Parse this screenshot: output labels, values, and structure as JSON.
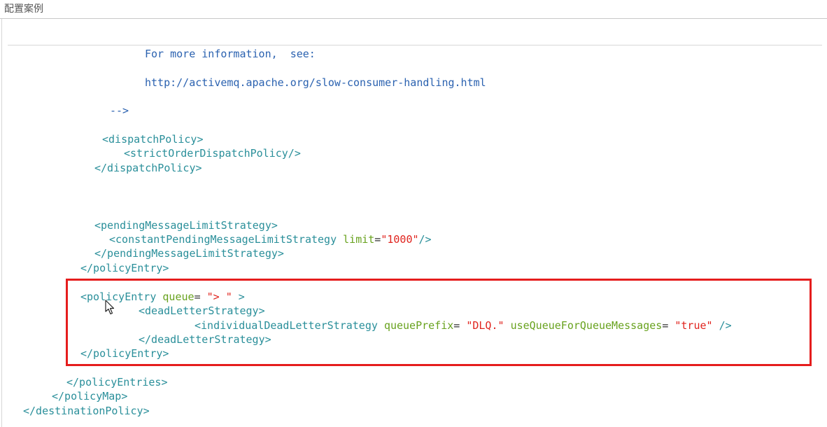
{
  "header": {
    "title": "配置案例"
  },
  "code": {
    "comment_1": "For more information,  see:",
    "comment_2": "http://activemq.apache.org/slow-consumer-handling.html",
    "comment_end": "-->",
    "dispatch_open": "<dispatchPolicy>",
    "strict_order": "<strictOrderDispatchPolicy/>",
    "dispatch_close": "</dispatchPolicy>",
    "pending_open": "<pendingMessageLimitStrategy>",
    "constant_open": "<constantPendingMessageLimitStrategy",
    "limit_attr": "limit",
    "limit_eq": "=",
    "limit_val": "\"1000\"",
    "constant_close": "/>",
    "pending_close": "</pendingMessageLimitStrategy>",
    "policy_entry_close_1": "</policyEntry>",
    "policy_entry_open": "<policyEntry",
    "queue_attr": "queue",
    "queue_eq": "=",
    "queue_val": "\"> \"",
    "policy_entry_gt": ">",
    "dls_open": "<deadLetterStrategy>",
    "idls_open": "<individualDeadLetterStrategy",
    "prefix_attr": "queuePrefix",
    "prefix_eq": "=",
    "prefix_val": "\"DLQ.\"",
    "useq_attr": "useQueueForQueueMessages",
    "useq_eq": "=",
    "useq_val": "\"true\"",
    "idls_close": "/>",
    "dls_close": "</deadLetterStrategy>",
    "policy_entry_close_2": "</policyEntry>",
    "policy_entries_close": "</policyEntries>",
    "policy_map_close": "</policyMap>",
    "destination_policy_close": "</destinationPolicy>"
  },
  "highlight": {
    "color": "#e51d1d"
  },
  "icons": {
    "cursor": "mouse-pointer-icon"
  }
}
